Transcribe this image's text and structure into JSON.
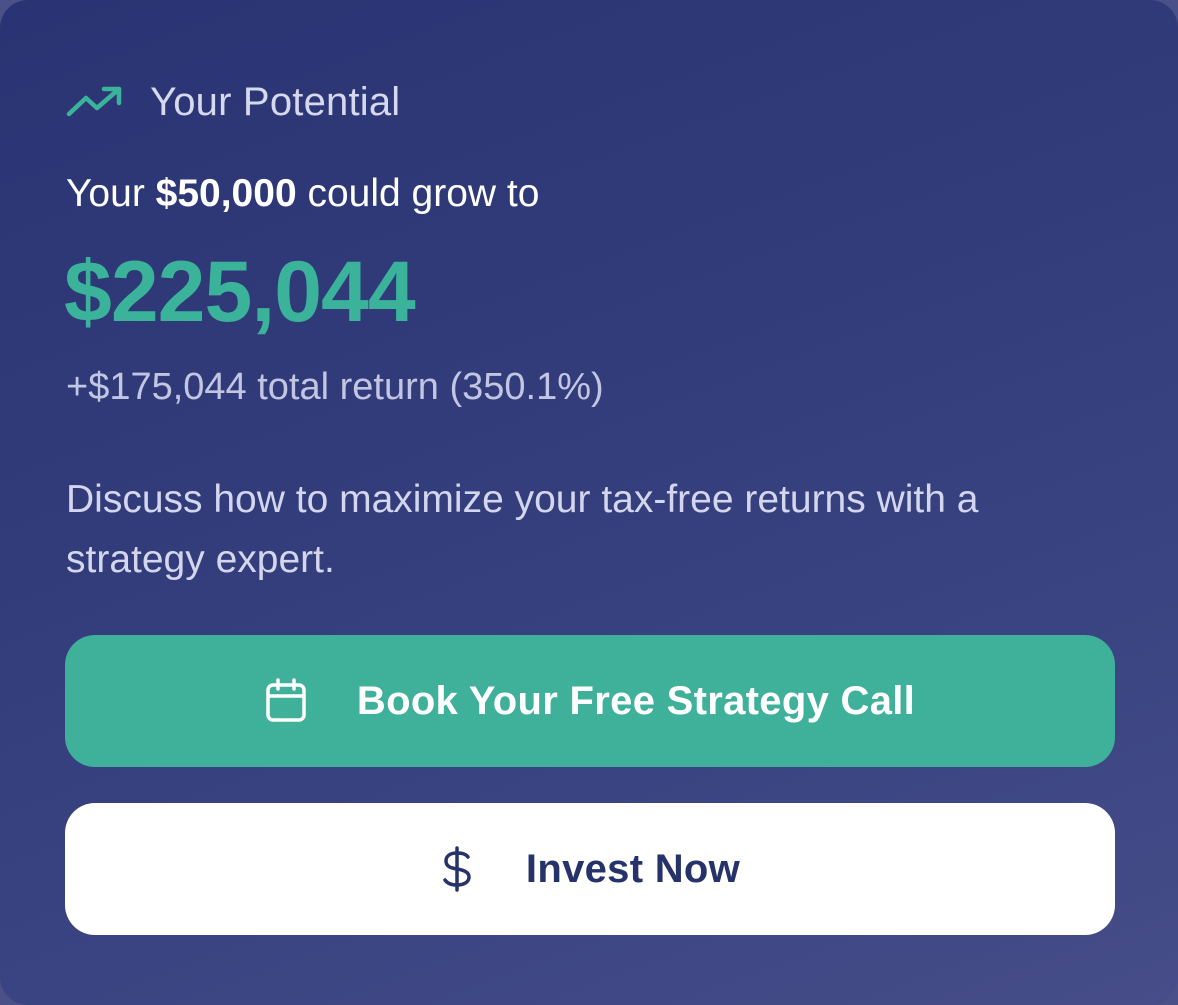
{
  "header": {
    "icon": "trending-up-icon",
    "title": "Your Potential"
  },
  "summary": {
    "intro_prefix": "Your",
    "initial_amount": "$50,000",
    "intro_suffix": "could grow to",
    "future_value": "$225,044",
    "total_return_text": "+$175,044 total return (350.1%)"
  },
  "description": "Discuss how to maximize your tax-free returns with a strategy expert.",
  "actions": {
    "primary": {
      "icon": "calendar-icon",
      "label": "Book Your Free Strategy Call"
    },
    "secondary": {
      "icon": "dollar-icon",
      "label": "Invest Now"
    }
  },
  "colors": {
    "accent": "#3fb09a",
    "card_background": "#323c7a",
    "secondary_button_text": "#26336b"
  }
}
